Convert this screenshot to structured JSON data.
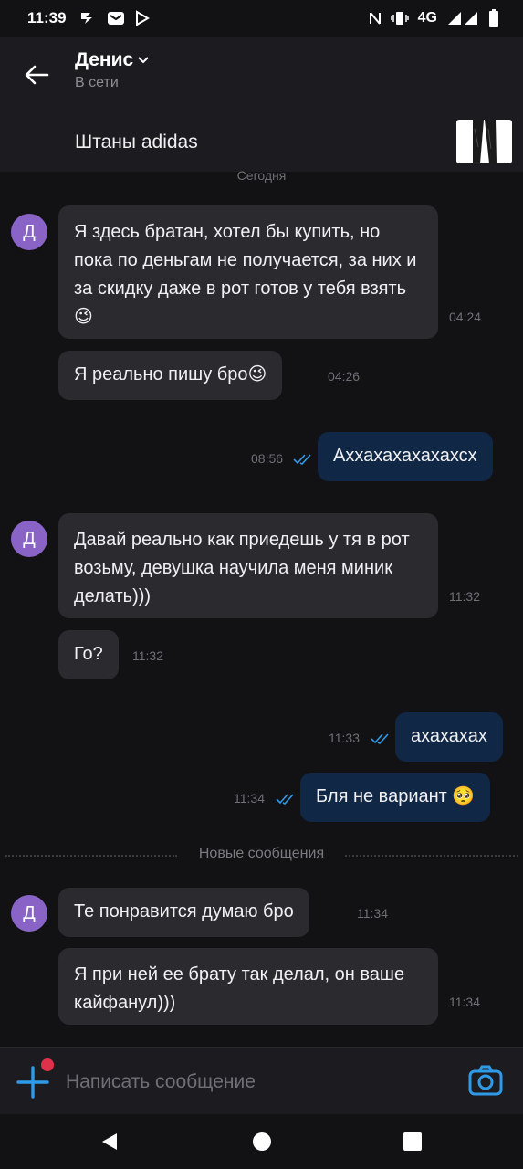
{
  "status_bar": {
    "time": "11:39",
    "network": "4G",
    "icons": [
      "data-saver-icon",
      "mail-icon",
      "play-store-icon",
      "nfc-icon",
      "vibrate-icon",
      "signal-icon",
      "battery-icon"
    ]
  },
  "header": {
    "contact_name": "Денис",
    "contact_status": "В сети"
  },
  "listing": {
    "title": "Штаны adidas"
  },
  "chat": {
    "date_separator": "Сегодня",
    "avatar_letter": "Д",
    "messages": [
      {
        "direction": "in",
        "text": "Я здесь братан, хотел бы купить, но пока по деньгам не получается, за них и за скидку даже в рот готов у тебя взять😉",
        "time": "04:24"
      },
      {
        "direction": "in",
        "text": "Я реально пишу бро😉",
        "time": "04:26"
      },
      {
        "direction": "out",
        "text": "Аххахахахахахсх",
        "time": "08:56",
        "read": true
      },
      {
        "direction": "in",
        "text": "Давай реально как приедешь у тя в рот возьму, девушка научила меня миник делать)))",
        "time": "11:32"
      },
      {
        "direction": "in",
        "text": "Го?",
        "time": "11:32"
      },
      {
        "direction": "out",
        "text": "ахахахах",
        "time": "11:33",
        "read": true
      },
      {
        "direction": "out",
        "text": "Бля не вариант 🥺",
        "time": "11:34",
        "read": true
      },
      {
        "direction": "in",
        "text": "Те понравится думаю бро",
        "time": "11:34"
      },
      {
        "direction": "in",
        "text": "Я при ней ее брату так делал, он ваше кайфанул)))",
        "time": "11:34"
      }
    ],
    "new_messages_label": "Новые сообщения"
  },
  "composer": {
    "placeholder": "Написать сообщение"
  },
  "colors": {
    "background": "#121215",
    "incoming_bubble": "#2a2a2f",
    "outgoing_bubble": "#102745",
    "accent": "#2f9be8",
    "avatar": "#8a63c6",
    "badge": "#e0314a"
  }
}
